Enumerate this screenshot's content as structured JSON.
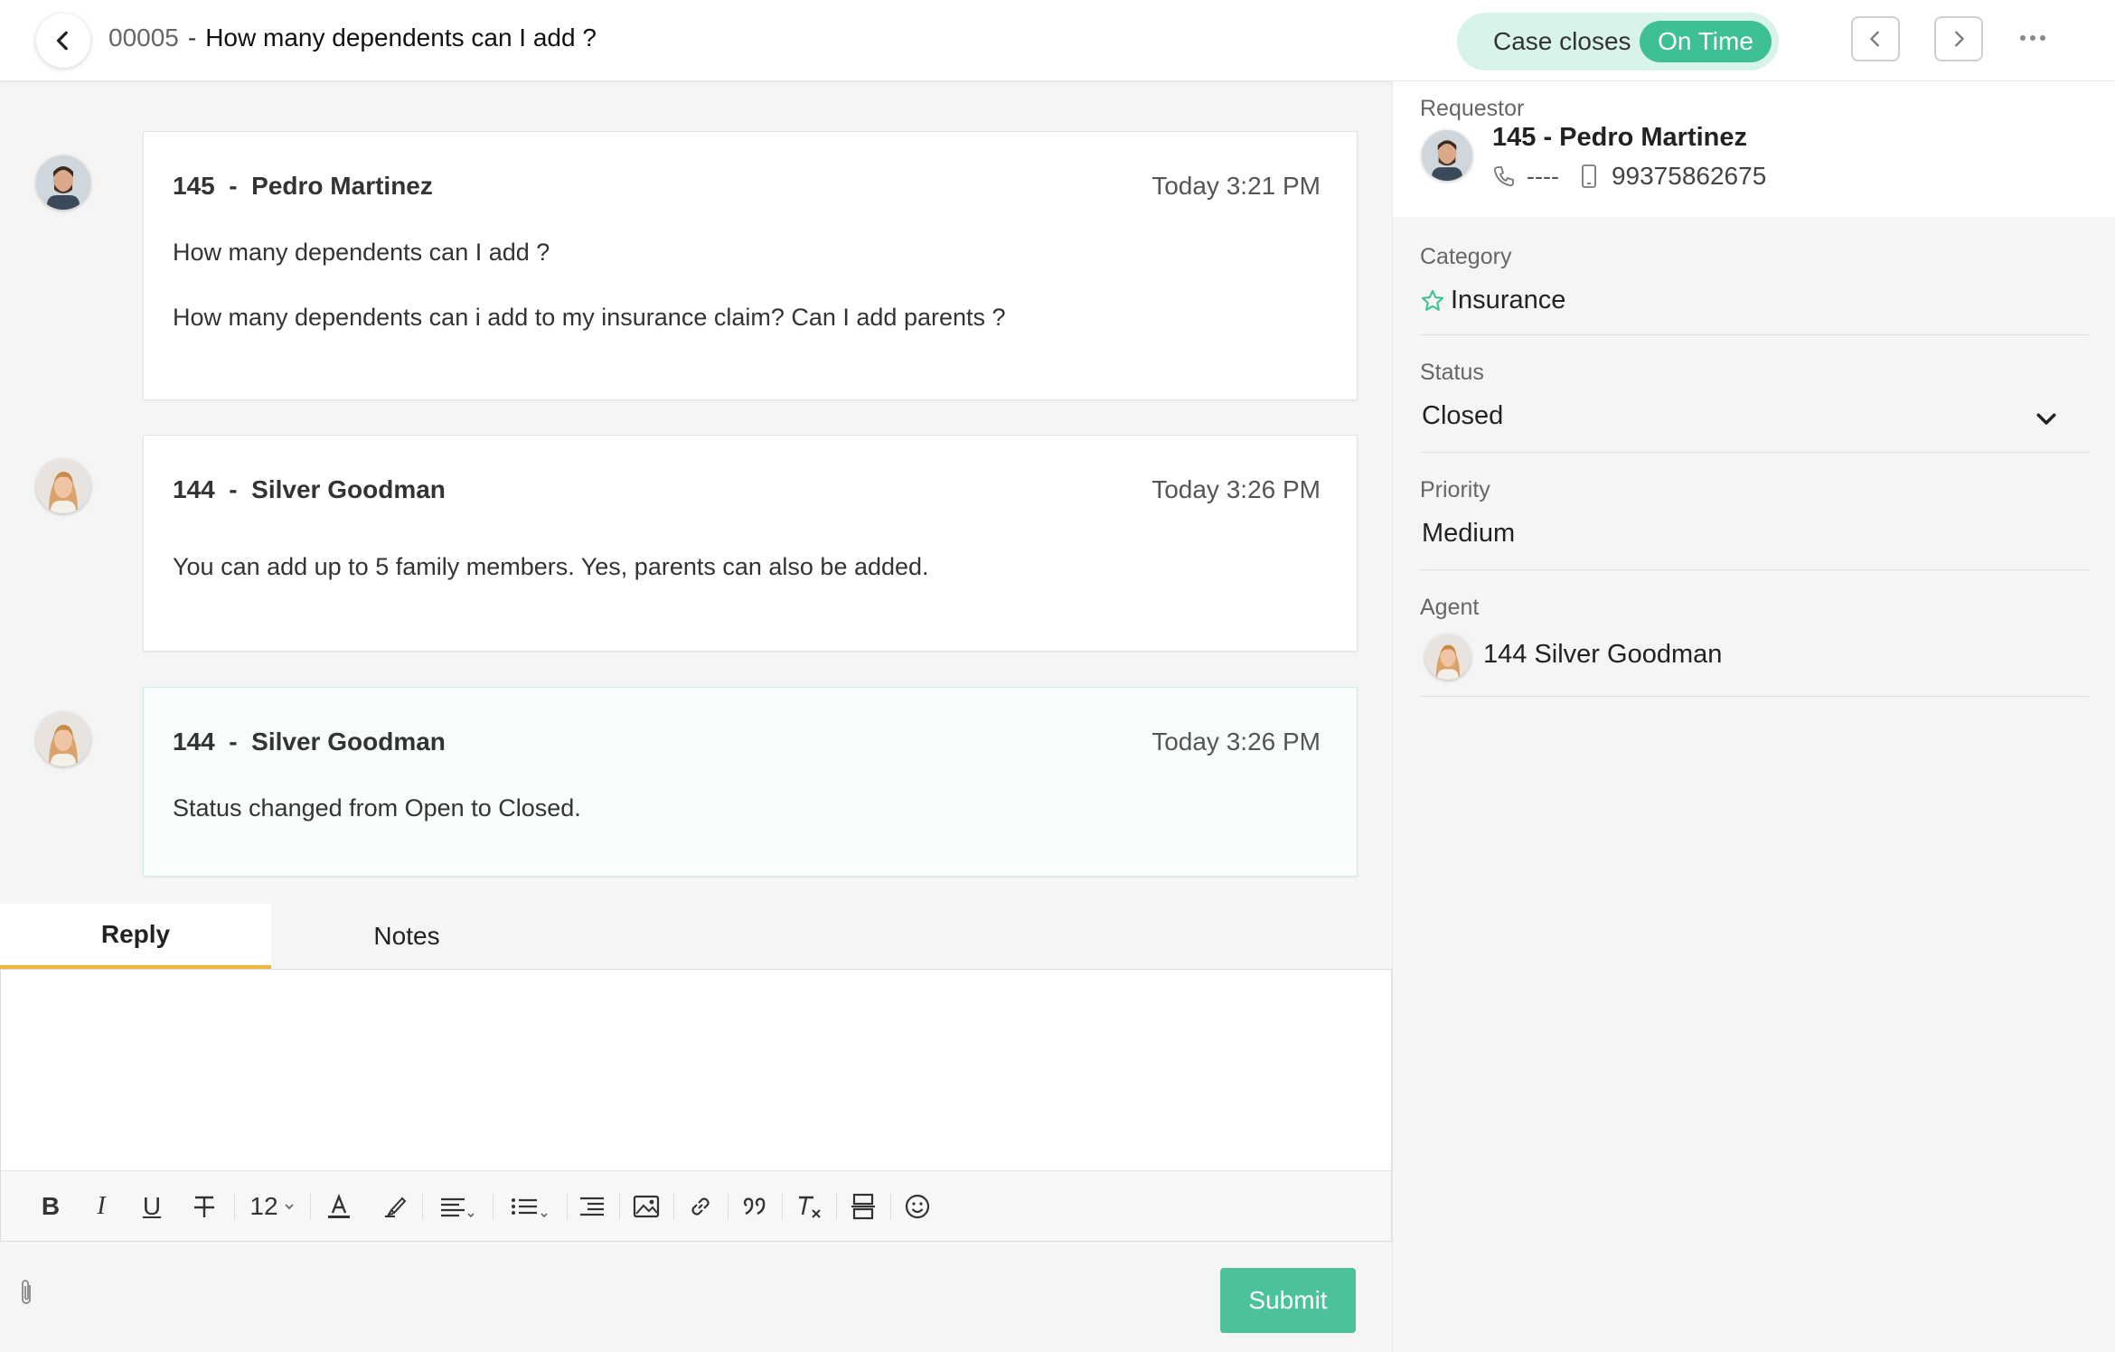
{
  "header": {
    "ticket_number": "00005",
    "separator": "-",
    "subject": "How many dependents can I add ?",
    "case_closes_label": "Case closes",
    "on_time_label": "On Time"
  },
  "colors": {
    "accent_green": "#3fbf96",
    "pill_bg": "#d8f2ec",
    "tab_underline": "#f0b43c",
    "submit_bg": "#4cc29a"
  },
  "conversation": [
    {
      "id": "145",
      "sep": "-",
      "name": "Pedro Martinez",
      "time": "Today 3:21 PM",
      "lines": [
        "How many dependents can I add ?",
        "How many dependents can i add to my insurance claim? Can I add parents ?"
      ]
    },
    {
      "id": "144",
      "sep": "-",
      "name": "Silver Goodman",
      "time": "Today 3:26 PM",
      "lines": [
        "You can add up to 5 family members. Yes, parents can also be added."
      ]
    },
    {
      "id": "144",
      "sep": "-",
      "name": "Silver Goodman",
      "time": "Today 3:26 PM",
      "lines": [
        "Status changed from Open to Closed."
      ]
    }
  ],
  "tabs": [
    {
      "label": "Reply",
      "active": true
    },
    {
      "label": "Notes",
      "active": false
    }
  ],
  "toolbar": {
    "bold": "B",
    "italic": "I",
    "underline": "U",
    "font_size": "12"
  },
  "submit_label": "Submit",
  "requestor": {
    "label": "Requestor",
    "name": "145 - Pedro Martinez",
    "phone": "----",
    "mobile": "99375862675"
  },
  "fields": {
    "category": {
      "label": "Category",
      "value": "Insurance"
    },
    "status": {
      "label": "Status",
      "value": "Closed"
    },
    "priority": {
      "label": "Priority",
      "value": "Medium"
    },
    "agent": {
      "label": "Agent",
      "value": "144 Silver Goodman"
    }
  }
}
